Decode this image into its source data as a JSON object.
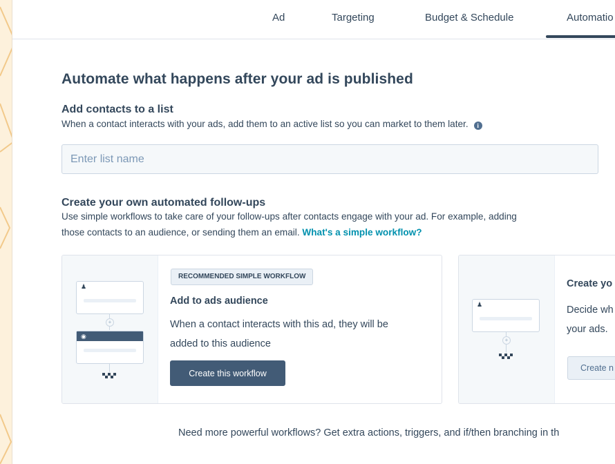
{
  "colors": {
    "background": "#fdf1dc",
    "panel": "#ffffff",
    "text": "#33475b",
    "link": "#0091ae",
    "primary_button": "#425b76",
    "input_bg": "#f5f8fa"
  },
  "tabs": [
    {
      "label": "Ad"
    },
    {
      "label": "Targeting"
    },
    {
      "label": "Budget & Schedule"
    },
    {
      "label": "Automatio",
      "active": true
    }
  ],
  "page_title": "Automate what happens after your ad is published",
  "list_section": {
    "title": "Add contacts to a list",
    "description": "When a contact interacts with your ads, add them to an active list so you can market to them later.",
    "info_icon": "i",
    "input_placeholder": "Enter list name",
    "input_value": ""
  },
  "followups_section": {
    "title": "Create your own automated follow-ups",
    "description_line1": "Use simple workflows to take care of your follow-ups after contacts engage with your ad. For example, adding",
    "description_line2": "those contacts to an audience, or sending them an email.",
    "help_link": "What's a simple workflow?"
  },
  "cards": [
    {
      "badge": "RECOMMENDED SIMPLE WORKFLOW",
      "title": "Add to ads audience",
      "body_line1": "When a contact interacts with this ad, they will be",
      "body_line2": "added to this audience",
      "button": "Create this workflow",
      "icons": [
        "contact-icon",
        "plus-icon",
        "target-icon",
        "finish-flag-icon"
      ]
    },
    {
      "title": "Create yo",
      "body_line1": "Decide wh",
      "body_line2": "your ads.",
      "button": "Create n",
      "icons": [
        "contact-icon",
        "plus-icon",
        "finish-flag-icon"
      ]
    }
  ],
  "footer_note": "Need more powerful workflows? Get extra actions, triggers, and if/then branching in th"
}
